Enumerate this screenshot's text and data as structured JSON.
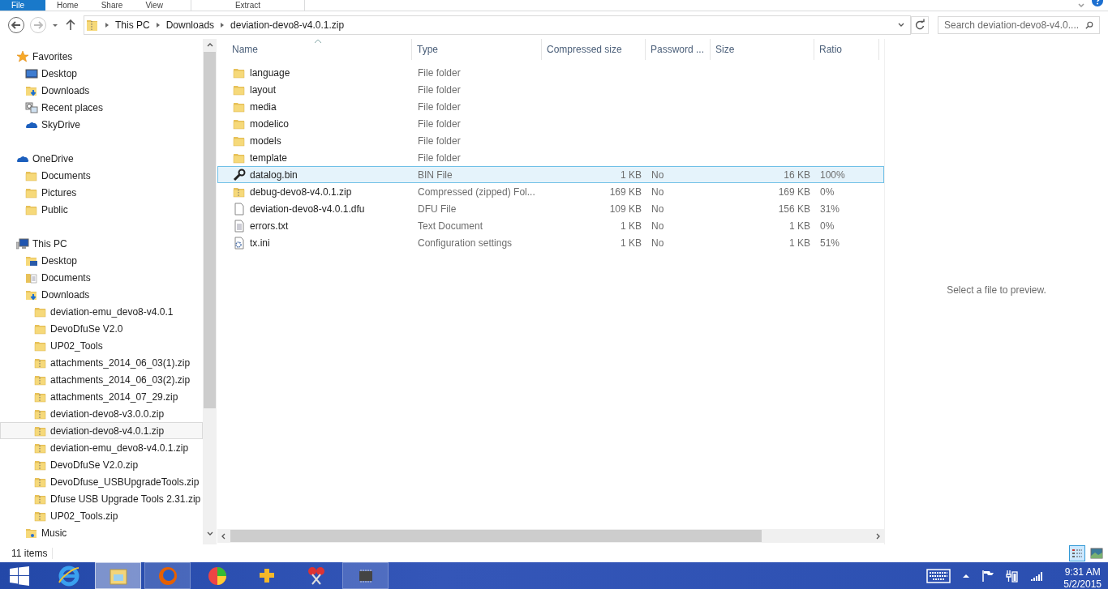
{
  "ribbon": {
    "tabs": [
      {
        "label": "File",
        "selected": true
      },
      {
        "label": "Home",
        "selected": false
      },
      {
        "label": "Share",
        "selected": false
      },
      {
        "label": "View",
        "selected": false
      },
      {
        "label": "Extract",
        "selected": false
      }
    ]
  },
  "address_bar": {
    "path": [
      "This PC",
      "Downloads",
      "deviation-devo8-v4.0.1.zip"
    ]
  },
  "search": {
    "placeholder": "Search deviation-devo8-v4.0...."
  },
  "nav_pane": {
    "groups": [
      {
        "label": "Favorites",
        "kind": "star",
        "selected": false,
        "children": [
          {
            "label": "Desktop",
            "kind": "desktop",
            "selected": false
          },
          {
            "label": "Downloads",
            "kind": "downloads",
            "selected": false
          },
          {
            "label": "Recent places",
            "kind": "recent",
            "selected": false
          },
          {
            "label": "SkyDrive",
            "kind": "cloud",
            "selected": false
          }
        ]
      },
      {
        "label": "OneDrive",
        "kind": "cloud",
        "selected": false,
        "children": [
          {
            "label": "Documents",
            "kind": "folder",
            "selected": false
          },
          {
            "label": "Pictures",
            "kind": "folder",
            "selected": false
          },
          {
            "label": "Public",
            "kind": "folder",
            "selected": false
          }
        ]
      },
      {
        "label": "This PC",
        "kind": "pc",
        "selected": false,
        "children": [
          {
            "label": "Desktop",
            "kind": "desktop-folder",
            "selected": false
          },
          {
            "label": "Documents",
            "kind": "documents",
            "selected": false
          },
          {
            "label": "Downloads",
            "kind": "downloads",
            "selected": false,
            "children": [
              {
                "label": "deviation-emu_devo8-v4.0.1",
                "kind": "folder",
                "selected": false
              },
              {
                "label": "DevoDfuSe V2.0",
                "kind": "folder",
                "selected": false
              },
              {
                "label": "UP02_Tools",
                "kind": "folder",
                "selected": false
              },
              {
                "label": "attachments_2014_06_03(1).zip",
                "kind": "zip",
                "selected": false
              },
              {
                "label": "attachments_2014_06_03(2).zip",
                "kind": "zip",
                "selected": false
              },
              {
                "label": "attachments_2014_07_29.zip",
                "kind": "zip",
                "selected": false
              },
              {
                "label": "deviation-devo8-v3.0.0.zip",
                "kind": "zip",
                "selected": false
              },
              {
                "label": "deviation-devo8-v4.0.1.zip",
                "kind": "zip",
                "selected": true
              },
              {
                "label": "deviation-emu_devo8-v4.0.1.zip",
                "kind": "zip",
                "selected": false
              },
              {
                "label": "DevoDfuSe V2.0.zip",
                "kind": "zip",
                "selected": false
              },
              {
                "label": "DevoDfuse_USBUpgradeTools.zip",
                "kind": "zip",
                "selected": false
              },
              {
                "label": "Dfuse USB Upgrade Tools 2.31.zip",
                "kind": "zip",
                "selected": false
              },
              {
                "label": "UP02_Tools.zip",
                "kind": "zip",
                "selected": false
              }
            ]
          },
          {
            "label": "Music",
            "kind": "music",
            "selected": false
          }
        ]
      }
    ]
  },
  "table": {
    "columns": [
      {
        "label": "Name",
        "sorted": true
      },
      {
        "label": "Type",
        "sorted": false
      },
      {
        "label": "Compressed size",
        "sorted": false
      },
      {
        "label": "Password ...",
        "sorted": false
      },
      {
        "label": "Size",
        "sorted": false
      },
      {
        "label": "Ratio",
        "sorted": false
      }
    ],
    "rows": [
      {
        "kind": "folder",
        "cells": [
          "language",
          "File folder",
          "",
          "",
          "",
          ""
        ],
        "selected": false
      },
      {
        "kind": "folder",
        "cells": [
          "layout",
          "File folder",
          "",
          "",
          "",
          ""
        ],
        "selected": false
      },
      {
        "kind": "folder",
        "cells": [
          "media",
          "File folder",
          "",
          "",
          "",
          ""
        ],
        "selected": false
      },
      {
        "kind": "folder",
        "cells": [
          "modelico",
          "File folder",
          "",
          "",
          "",
          ""
        ],
        "selected": false
      },
      {
        "kind": "folder",
        "cells": [
          "models",
          "File folder",
          "",
          "",
          "",
          ""
        ],
        "selected": false
      },
      {
        "kind": "folder",
        "cells": [
          "template",
          "File folder",
          "",
          "",
          "",
          ""
        ],
        "selected": false
      },
      {
        "kind": "bin",
        "cells": [
          "datalog.bin",
          "BIN File",
          "1 KB",
          "No",
          "16 KB",
          "100%"
        ],
        "selected": true
      },
      {
        "kind": "zip",
        "cells": [
          "debug-devo8-v4.0.1.zip",
          "Compressed (zipped) Fol...",
          "169 KB",
          "No",
          "169 KB",
          "0%"
        ],
        "selected": false
      },
      {
        "kind": "file",
        "cells": [
          "deviation-devo8-v4.0.1.dfu",
          "DFU File",
          "109 KB",
          "No",
          "156 KB",
          "31%"
        ],
        "selected": false
      },
      {
        "kind": "text",
        "cells": [
          "errors.txt",
          "Text Document",
          "1 KB",
          "No",
          "1 KB",
          "0%"
        ],
        "selected": false
      },
      {
        "kind": "settings",
        "cells": [
          "tx.ini",
          "Configuration settings",
          "1 KB",
          "No",
          "1 KB",
          "51%"
        ],
        "selected": false
      }
    ]
  },
  "preview": {
    "message": "Select a file to preview."
  },
  "status_bar": {
    "count": "11 items",
    "views": [
      {
        "kind": "details",
        "selected": true
      },
      {
        "kind": "large-icons",
        "selected": false
      }
    ]
  },
  "taskbar": {
    "apps": [
      {
        "kind": "ie",
        "selected": false
      },
      {
        "kind": "explorer",
        "selected": true
      },
      {
        "kind": "firefox",
        "selected": false
      },
      {
        "kind": "colorball",
        "selected": false
      },
      {
        "kind": "puzzle",
        "selected": false
      },
      {
        "kind": "scissors",
        "selected": false
      },
      {
        "kind": "chip",
        "selected": false
      }
    ],
    "time": "9:31 AM",
    "date": "5/2/2015"
  }
}
